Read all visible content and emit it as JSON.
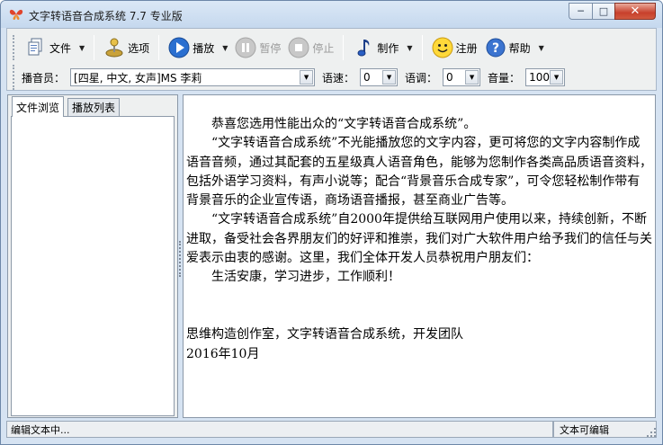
{
  "window": {
    "title": "文字转语音合成系统 7.7 专业版",
    "controls": {
      "minimize": "─",
      "maximize": "□",
      "close": "✕"
    }
  },
  "toolbar": {
    "file_label": "文件",
    "options_label": "选项",
    "play_label": "播放",
    "pause_label": "暂停",
    "stop_label": "停止",
    "make_label": "制作",
    "register_label": "注册",
    "help_label": "帮助"
  },
  "voicebar": {
    "announcer_label": "播音员：",
    "announcer_value": "[四星, 中文, 女声]MS 李莉",
    "speed_label": "语速：",
    "speed_value": "0",
    "pitch_label": "语调：",
    "pitch_value": "0",
    "volume_label": "音量：",
    "volume_value": "100"
  },
  "tabs": {
    "file_browse": "文件浏览",
    "playlist": "播放列表"
  },
  "editor": {
    "lines": [
      "恭喜您选用性能出众的“文字转语音合成系统”。",
      "“文字转语音合成系统”不光能播放您的文字内容，更可将您的文字内容制作成语音音频，通过其配套的五星级真人语音角色，能够为您制作各类高品质语音资料，包括外语学习资料，有声小说等；配合“背景音乐合成专家”，可令您轻松制作带有背景音乐的企业宣传语，商场语音播报，甚至商业广告等。",
      "“文字转语音合成系统”自2000年提供给互联网用户使用以来，持续创新，不断进取，备受社会各界朋友们的好评和推崇，我们对广大软件用户给予我们的信任与关爱表示由衷的感谢。这里，我们全体开发人员恭祝用户朋友们：",
      "生活安康，学习进步，工作顺利！",
      "思维构造创作室，文字转语音合成系统，开发团队",
      "2016年10月"
    ]
  },
  "status": {
    "left": "编辑文本中...",
    "right": "文本可编辑"
  },
  "colors": {
    "accent": "#2a6fd0",
    "frame": "#d6e3f2",
    "close": "#c7402c"
  }
}
